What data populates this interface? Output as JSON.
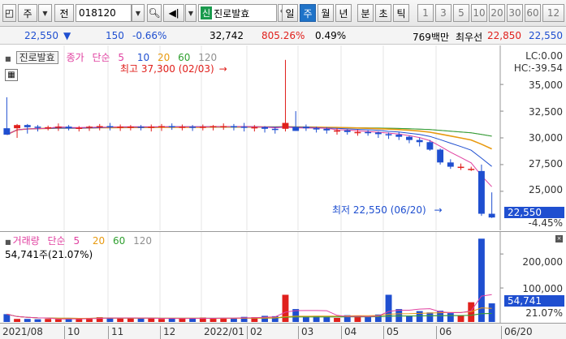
{
  "toolbar": {
    "market": "주",
    "period_prefix": "전",
    "code": "018120",
    "name_badge": "신",
    "name": "진로발효",
    "periods": [
      "일",
      "주",
      "월",
      "년",
      "분",
      "초",
      "틱"
    ],
    "active_period": "주",
    "intervals": [
      "1",
      "3",
      "5",
      "10",
      "20",
      "30",
      "60",
      "12"
    ]
  },
  "quote": {
    "price": "22,550",
    "direction": "▼",
    "change": "150",
    "change_pct": "-0.66%",
    "volume": "32,742",
    "vol_ratio": "805.26%",
    "turnover_pct": "0.49%",
    "trade_value": "769백만",
    "best_label": "최우선",
    "best_ask": "22,850",
    "best_bid": "22,550"
  },
  "price_pane": {
    "title": "진로발효",
    "legend": {
      "close": "종가",
      "ma": "단순",
      "periods": [
        "5",
        "10",
        "20",
        "60",
        "120"
      ]
    },
    "high_note": "최고 37,300 (02/03)",
    "low_note": "최저 22,550 (06/20)",
    "lc": "LC:0.00",
    "hc": "HC:-39.54",
    "y_ticks": [
      "35,000",
      "32,500",
      "30,000",
      "27,500",
      "25,000"
    ],
    "current_tag": "22,550",
    "current_pct": "-4.45%"
  },
  "volume_pane": {
    "title": "거래량",
    "ma": "단순",
    "periods": [
      "5",
      "20",
      "60",
      "120"
    ],
    "current_text": "54,741주(21.07%)",
    "y_ticks": [
      "200,000",
      "100,000"
    ],
    "current_tag": "54,741",
    "current_pct": "21.07%"
  },
  "date_axis": {
    "labels": [
      "2021/08",
      "10",
      "11",
      "12",
      "2022/01",
      "02",
      "03",
      "04",
      "05",
      "06"
    ],
    "cursor": "06/20"
  },
  "colors": {
    "up": "#e0201c",
    "down": "#1f4fd0",
    "ma5": "#e040a0",
    "ma10": "#1f4fd0",
    "ma20": "#e89a10",
    "ma60": "#30a030",
    "ma120": "#909090"
  },
  "chart_data": {
    "type": "candlestick",
    "x": [
      "2021-07-26",
      "2021-08-02",
      "2021-08-09",
      "2021-08-16",
      "2021-08-23",
      "2021-08-30",
      "2021-09-06",
      "2021-09-13",
      "2021-09-20",
      "2021-09-27",
      "2021-10-04",
      "2021-10-11",
      "2021-10-18",
      "2021-10-25",
      "2021-11-01",
      "2021-11-08",
      "2021-11-15",
      "2021-11-22",
      "2021-11-29",
      "2021-12-06",
      "2021-12-13",
      "2021-12-20",
      "2021-12-27",
      "2022-01-03",
      "2022-01-10",
      "2022-01-17",
      "2022-01-24",
      "2022-01-31",
      "2022-02-07",
      "2022-02-14",
      "2022-02-21",
      "2022-02-28",
      "2022-03-07",
      "2022-03-14",
      "2022-03-21",
      "2022-03-28",
      "2022-04-04",
      "2022-04-11",
      "2022-04-18",
      "2022-04-25",
      "2022-05-02",
      "2022-05-09",
      "2022-05-16",
      "2022-05-23",
      "2022-05-30",
      "2022-06-06",
      "2022-06-13",
      "2022-06-20"
    ],
    "open": [
      30900,
      30900,
      31200,
      31050,
      30950,
      31000,
      31050,
      30900,
      30950,
      31050,
      31100,
      31000,
      31050,
      31050,
      31000,
      31050,
      31100,
      31050,
      31050,
      31000,
      31050,
      31100,
      31100,
      31050,
      31000,
      31000,
      30850,
      30850,
      31000,
      31050,
      30900,
      30850,
      30700,
      30700,
      30550,
      30550,
      30500,
      30350,
      30300,
      30100,
      29800,
      29600,
      28900,
      27700,
      27300,
      27100,
      26900,
      22900
    ],
    "high": [
      33800,
      31300,
      31300,
      31200,
      31150,
      31350,
      31200,
      31100,
      31150,
      31300,
      31400,
      31250,
      31200,
      31200,
      31250,
      31300,
      31350,
      31250,
      31200,
      31250,
      31200,
      31350,
      31300,
      31400,
      31200,
      31100,
      31000,
      37300,
      32500,
      31250,
      31050,
      31000,
      30900,
      30800,
      30750,
      30700,
      30600,
      30500,
      30550,
      30200,
      30000,
      29800,
      29000,
      28000,
      27600,
      27300,
      27500,
      24900
    ],
    "low": [
      30300,
      30000,
      30400,
      30600,
      30700,
      30650,
      30700,
      30600,
      30650,
      30700,
      30700,
      30650,
      30700,
      30700,
      30600,
      30650,
      30750,
      30700,
      30650,
      30700,
      30700,
      30750,
      30700,
      30600,
      30600,
      30500,
      30400,
      30600,
      30650,
      30650,
      30500,
      30400,
      30300,
      30300,
      30200,
      30200,
      30000,
      29900,
      29800,
      29500,
      29200,
      28800,
      27500,
      27100,
      27000,
      26900,
      22700,
      22500
    ],
    "close": [
      30300,
      31200,
      31000,
      30950,
      31000,
      31050,
      30900,
      30950,
      31050,
      31100,
      31000,
      31050,
      31050,
      31000,
      31050,
      31100,
      31050,
      31050,
      31000,
      31050,
      31100,
      31100,
      31050,
      31000,
      31000,
      30850,
      30800,
      31400,
      30650,
      30900,
      30850,
      30700,
      30700,
      30550,
      30550,
      30500,
      30350,
      30300,
      30100,
      29800,
      29600,
      28900,
      27700,
      27300,
      27300,
      27100,
      22900,
      22550
    ],
    "volume": [
      23000,
      9000,
      9000,
      8000,
      9000,
      8000,
      10000,
      9000,
      12000,
      14000,
      13000,
      10000,
      11000,
      10000,
      12000,
      9000,
      10000,
      10000,
      11000,
      13000,
      10000,
      12000,
      11000,
      15000,
      14000,
      18000,
      17000,
      80000,
      38000,
      15000,
      18000,
      15000,
      12000,
      20000,
      18000,
      15000,
      22000,
      80000,
      38000,
      18000,
      32000,
      28000,
      33000,
      26000,
      18000,
      58000,
      245000,
      54741
    ],
    "ylim_price": [
      21500,
      38500
    ],
    "ylim_volume": [
      0,
      260000
    ]
  }
}
